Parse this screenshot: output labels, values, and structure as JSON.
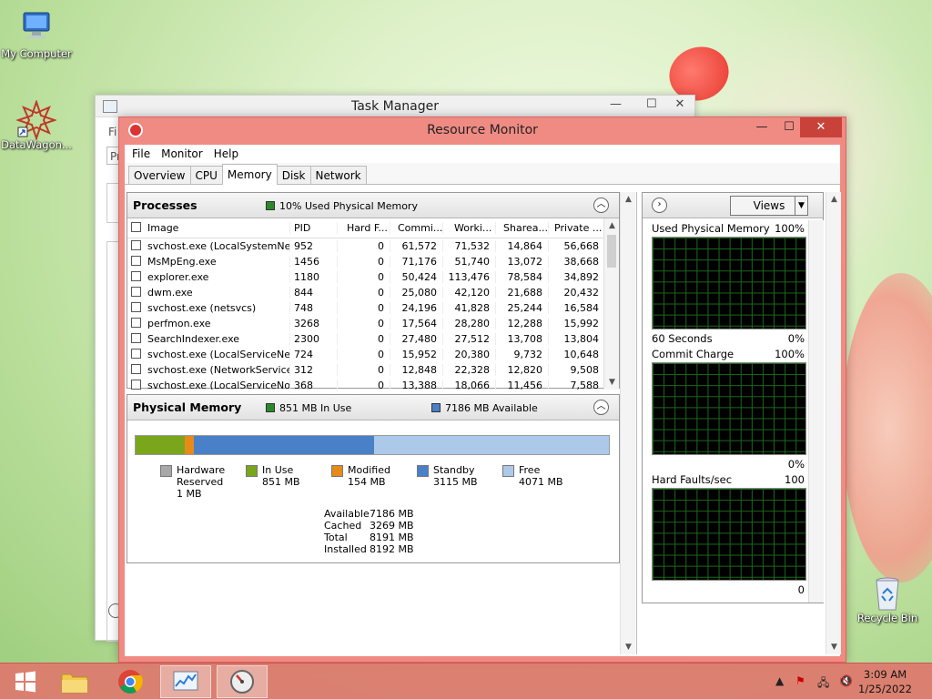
{
  "desktop": {
    "icons": [
      {
        "label": "My Computer"
      },
      {
        "label": "DataWagon..."
      },
      {
        "label": "Recycle Bin"
      }
    ]
  },
  "task_manager": {
    "title": "Task Manager",
    "menu_fragment": "Fi",
    "tab_fragment": "Pr"
  },
  "resource_monitor": {
    "title": "Resource Monitor",
    "menu": [
      "File",
      "Monitor",
      "Help"
    ],
    "tabs": [
      "Overview",
      "CPU",
      "Memory",
      "Disk",
      "Network"
    ],
    "selected_tab": "Memory",
    "processes": {
      "title": "Processes",
      "status": "10% Used Physical Memory",
      "columns": [
        "Image",
        "PID",
        "Hard F...",
        "Commi...",
        "Worki...",
        "Sharea...",
        "Private ..."
      ],
      "rows": [
        [
          "svchost.exe (LocalSystemNet...",
          "952",
          "0",
          "61,572",
          "71,532",
          "14,864",
          "56,668"
        ],
        [
          "MsMpEng.exe",
          "1456",
          "0",
          "71,176",
          "51,740",
          "13,072",
          "38,668"
        ],
        [
          "explorer.exe",
          "1180",
          "0",
          "50,424",
          "113,476",
          "78,584",
          "34,892"
        ],
        [
          "dwm.exe",
          "844",
          "0",
          "25,080",
          "42,120",
          "21,688",
          "20,432"
        ],
        [
          "svchost.exe (netsvcs)",
          "748",
          "0",
          "24,196",
          "41,828",
          "25,244",
          "16,584"
        ],
        [
          "perfmon.exe",
          "3268",
          "0",
          "17,564",
          "28,280",
          "12,288",
          "15,992"
        ],
        [
          "SearchIndexer.exe",
          "2300",
          "0",
          "27,480",
          "27,512",
          "13,708",
          "13,804"
        ],
        [
          "svchost.exe (LocalServiceNet...",
          "724",
          "0",
          "15,952",
          "20,380",
          "9,732",
          "10,648"
        ],
        [
          "svchost.exe (NetworkService)",
          "312",
          "0",
          "12,848",
          "22,328",
          "12,820",
          "9,508"
        ],
        [
          "svchost.exe (LocalServiceNo...",
          "368",
          "0",
          "13,388",
          "18,066",
          "11,456",
          "7,588"
        ]
      ]
    },
    "physical_memory": {
      "title": "Physical Memory",
      "in_use_status": "851 MB In Use",
      "available_status": "7186 MB Available",
      "bar": [
        {
          "name": "In Use",
          "mb": 851,
          "color": "#7aa61c"
        },
        {
          "name": "Modified",
          "mb": 154,
          "color": "#e88a1a"
        },
        {
          "name": "Standby",
          "mb": 3115,
          "color": "#4a80c8"
        },
        {
          "name": "Free",
          "mb": 4071,
          "color": "#adc9ea"
        }
      ],
      "legend": [
        {
          "lines": [
            "Hardware",
            "Reserved",
            "1 MB"
          ],
          "color": "#a8a8a8"
        },
        {
          "lines": [
            "In Use",
            "851 MB"
          ],
          "color": "#7aa61c"
        },
        {
          "lines": [
            "Modified",
            "154 MB"
          ],
          "color": "#e88a1a"
        },
        {
          "lines": [
            "Standby",
            "3115 MB"
          ],
          "color": "#4a80c8"
        },
        {
          "lines": [
            "Free",
            "4071 MB"
          ],
          "color": "#adc9ea"
        }
      ],
      "stats": [
        {
          "k": "Available",
          "v": "7186 MB"
        },
        {
          "k": "Cached",
          "v": "3269 MB"
        },
        {
          "k": "Total",
          "v": "8191 MB"
        },
        {
          "k": "Installed",
          "v": "8192 MB"
        }
      ]
    },
    "graphs": {
      "views_label": "Views",
      "items": [
        {
          "title": "Used Physical Memory",
          "max": "100%",
          "min": "0%",
          "footer": "60 Seconds"
        },
        {
          "title": "Commit Charge",
          "max": "100%",
          "min": "0%"
        },
        {
          "title": "Hard Faults/sec",
          "max": "100",
          "min": "0"
        }
      ]
    }
  },
  "taskbar": {
    "time": "3:09 AM",
    "date": "1/25/2022"
  }
}
